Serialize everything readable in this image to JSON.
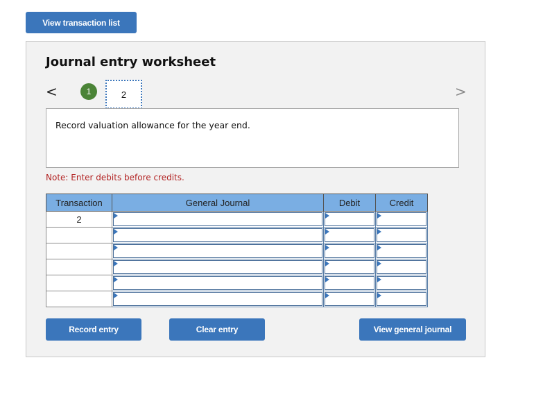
{
  "top": {
    "view_transaction_list": "View transaction list"
  },
  "worksheet": {
    "title": "Journal entry worksheet",
    "nav": {
      "prev_icon": "<",
      "next_icon": ">"
    },
    "steps": [
      {
        "label": "1",
        "state": "completed"
      },
      {
        "label": "2",
        "state": "current"
      }
    ],
    "description": "Record valuation allowance for the year end.",
    "note": "Note: Enter debits before credits."
  },
  "table": {
    "headers": [
      "Transaction",
      "General Journal",
      "Debit",
      "Credit"
    ],
    "rows": [
      {
        "transaction": "2",
        "account": "",
        "debit": "",
        "credit": ""
      },
      {
        "transaction": "",
        "account": "",
        "debit": "",
        "credit": ""
      },
      {
        "transaction": "",
        "account": "",
        "debit": "",
        "credit": ""
      },
      {
        "transaction": "",
        "account": "",
        "debit": "",
        "credit": ""
      },
      {
        "transaction": "",
        "account": "",
        "debit": "",
        "credit": ""
      },
      {
        "transaction": "",
        "account": "",
        "debit": "",
        "credit": ""
      }
    ]
  },
  "buttons": {
    "record_entry": "Record entry",
    "clear_entry": "Clear entry",
    "view_general_journal": "View general journal"
  },
  "colors": {
    "button": "#3b76bb",
    "header": "#7aaee3",
    "step_done": "#4b8437",
    "note": "#b22222"
  }
}
